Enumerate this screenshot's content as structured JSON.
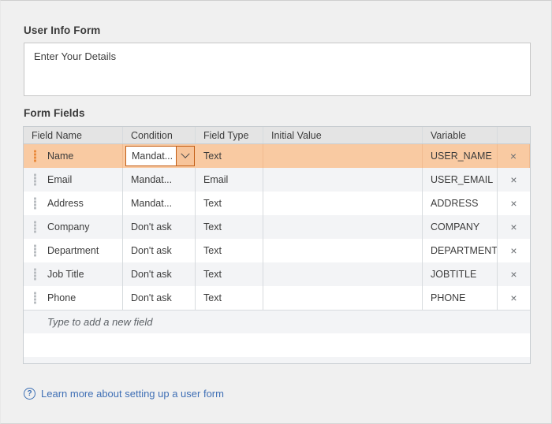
{
  "panel": {
    "user_info_form_label": "User Info Form",
    "form_fields_label": "Form Fields"
  },
  "description": {
    "value": "Enter Your Details",
    "placeholder": "Enter Your Details"
  },
  "table": {
    "columns": [
      "Field Name",
      "Condition",
      "Field Type",
      "Initial Value",
      "Variable",
      ""
    ],
    "rows": [
      {
        "field": "Name",
        "condition": "Mandat...",
        "type": "Text",
        "initial": "",
        "variable": "USER_NAME",
        "delete": "×",
        "selected": true,
        "editing": true
      },
      {
        "field": "Email",
        "condition": "Mandat...",
        "type": "Email",
        "initial": "",
        "variable": "USER_EMAIL",
        "delete": "×",
        "selected": false,
        "editing": false
      },
      {
        "field": "Address",
        "condition": "Mandat...",
        "type": "Text",
        "initial": "",
        "variable": "ADDRESS",
        "delete": "×",
        "selected": false,
        "editing": false
      },
      {
        "field": "Company",
        "condition": "Don't ask",
        "type": "Text",
        "initial": "",
        "variable": "COMPANY",
        "delete": "×",
        "selected": false,
        "editing": false
      },
      {
        "field": "Department",
        "condition": "Don't ask",
        "type": "Text",
        "initial": "",
        "variable": "DEPARTMENT",
        "delete": "×",
        "selected": false,
        "editing": false
      },
      {
        "field": "Job Title",
        "condition": "Don't ask",
        "type": "Text",
        "initial": "",
        "variable": "JOBTITLE",
        "delete": "×",
        "selected": false,
        "editing": false
      },
      {
        "field": "Phone",
        "condition": "Don't ask",
        "type": "Text",
        "initial": "",
        "variable": "PHONE",
        "delete": "×",
        "selected": false,
        "editing": false
      }
    ],
    "new_row_placeholder": "Type to add a new field"
  },
  "footer": {
    "help_icon": "question-circle-icon",
    "help_glyph": "?",
    "link_text": "Learn more about setting up a user form"
  },
  "colors": {
    "selected_row": "#f9caa2",
    "editor_border": "#c25d14",
    "link": "#3f6fb5",
    "header_bg": "#e4e4e4",
    "alt_row": "#f3f4f6"
  }
}
